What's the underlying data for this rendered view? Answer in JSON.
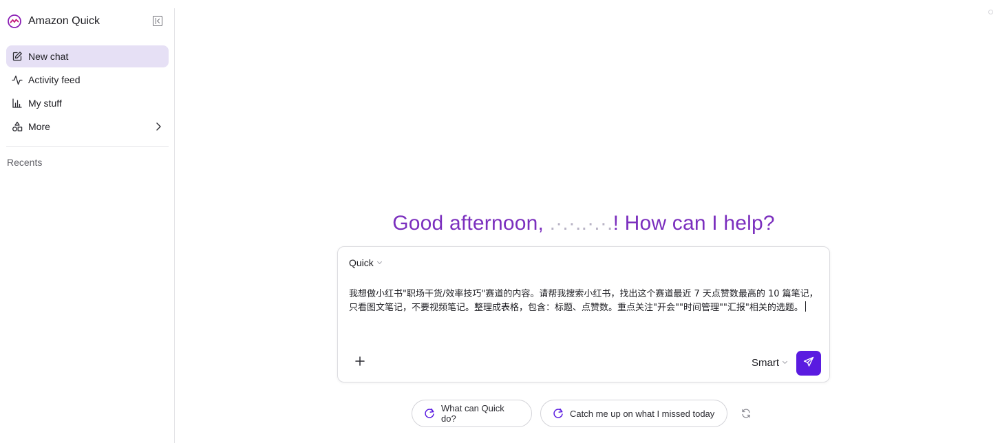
{
  "brand": {
    "name": "Amazon Quick",
    "logo_icon": "amazon-quick-logo",
    "collapse_icon": "sidebar-collapse-icon"
  },
  "nav": {
    "items": [
      {
        "label": "New chat",
        "icon": "pencil-square-icon",
        "active": true
      },
      {
        "label": "Activity feed",
        "icon": "activity-pulse-icon",
        "active": false
      },
      {
        "label": "My stuff",
        "icon": "bar-chart-icon",
        "active": false
      },
      {
        "label": "More",
        "icon": "shapes-icon",
        "active": false,
        "has_chevron": true
      }
    ]
  },
  "recents": {
    "label": "Recents"
  },
  "main": {
    "greeting_prefix": "Good afternoon, ",
    "greeting_name_masked": ".·.·..·.·.",
    "greeting_suffix": "! How can I help?",
    "composer": {
      "agent_label": "Quick",
      "prompt_value": "我想做小红书\"职场干货/效率技巧\"赛道的内容。请帮我搜索小红书，找出这个赛道最近 7 天点赞数最高的 10 篇笔记，只看图文笔记，不要视频笔记。整理成表格，包含：标题、点赞数。重点关注\"开会\"\"时间管理\"\"汇报\"相关的选题。",
      "model_label": "Smart",
      "attach_icon": "plus-icon",
      "send_icon": "paper-plane-icon"
    },
    "suggestions": [
      {
        "label": "What can Quick do?",
        "icon": "sparkle-loop-icon"
      },
      {
        "label": "Catch me up on what I missed today",
        "icon": "sparkle-loop-icon"
      }
    ],
    "refresh_icon": "refresh-icon"
  },
  "colors": {
    "accent": "#7b2fbe",
    "send_button": "#5a1be0",
    "active_nav_bg": "#e6e0f5"
  }
}
